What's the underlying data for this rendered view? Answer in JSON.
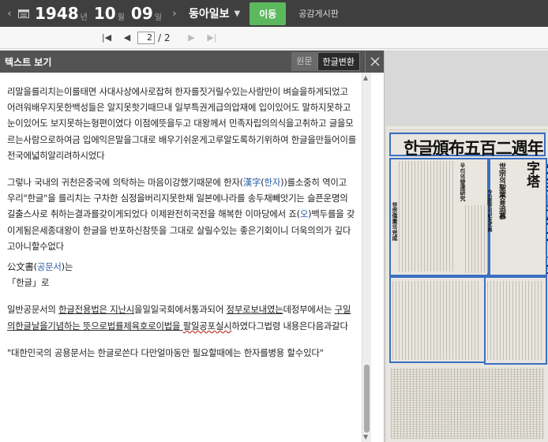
{
  "topbar": {
    "year": "1948",
    "year_unit": "년",
    "month": "10",
    "month_unit": "월",
    "day": "09",
    "day_unit": "일",
    "newspaper": "동아일보",
    "move_label": "이동",
    "board_label": "공감게시판"
  },
  "pager": {
    "current_page": "2",
    "total_pages": "/ 2"
  },
  "panel": {
    "title": "텍스트 보기",
    "original_label": "원문",
    "convert_label": "한글변환"
  },
  "text": {
    "p1": "리말을를리치는이를태면 사대사상에사로잡혀 한자를짓거릴수있는사람만이 벼슬을하게되었고 어려워배우지못한백성들은 알지못핫기때므내 일부특권게급의압재에 입이있어도 말하지못하고 눈이있어도 보지못하는형편이였다 이점에뜻을두고 대왕께서 민족자립의의식을고취하고 글을모르는사람으로하여금 입에익은말을그대로 배우기쉬운게고루알도록하기위하여 한글을만들어이를 전국에넓히알리려하시었다",
    "p2_a": " 그렇나 국내의 귀천은중국에 의탁하는 마음이강했기때문에 한자(",
    "p2_hanja1": "漢字",
    "p2_paren1": "(",
    "p2_hanja1_read": "한자",
    "p2_b": "))를소중히 역이고 우리\"한글\"을 를리치는 구차한 심정을버리지못한채 일본에나라를 송두채빼앗기는 슬픈운명의 길출스사로 취하는결과를갖이게되었다 이제완전히국전을 해복한 이마당에서 죠(",
    "p2_hanja2_read": "오",
    "p2_c": ")백두를을 갖이게됨은세종대왕이 한글을 반포하신참뜻을 그대로 살릴수있는 좋은기회이니 더욱의의가 깊다고아니할수없다",
    "p3_a": "公文書(",
    "p3_read": "공문서",
    "p3_b": ")는",
    "p4": "「한글」로",
    "p5_a": " 일반공문서의 ",
    "p5_u1": "한글전용법은 지난시",
    "p5_b": "을일일국회에서통과되어 ",
    "p5_u2": "정부로보내였는",
    "p5_c": "데정부에서는 ",
    "p5_u3": "구일의한글날을기념하는 뜻으로법률제육호로이법을 ",
    "p5_wavy": "팔일공포실시",
    "p5_d": "하였다그법령 내용은다음과갈다",
    "p6": " \"대한민국의 공용문서는 한글로쓴다 다만얼마동안 필요할때에는 한자를병용 할수있다\""
  },
  "newspaper_image": {
    "headline": "한글頒布五百二週年",
    "side_title": "燦然!民族文化의金字塔",
    "sub1": "世宗의聖業을追慕",
    "sub2": "今日奕世의紀念式典",
    "col1": "世宗偉業의完成",
    "col2": "우리의發達研究"
  },
  "colors": {
    "topbar_bg": "#3f3f3f",
    "move_button": "#5cb85c",
    "link_blue": "#2a5ea8",
    "highlight_box": "#3a6fc2",
    "wavy_underline": "#c0392b"
  }
}
